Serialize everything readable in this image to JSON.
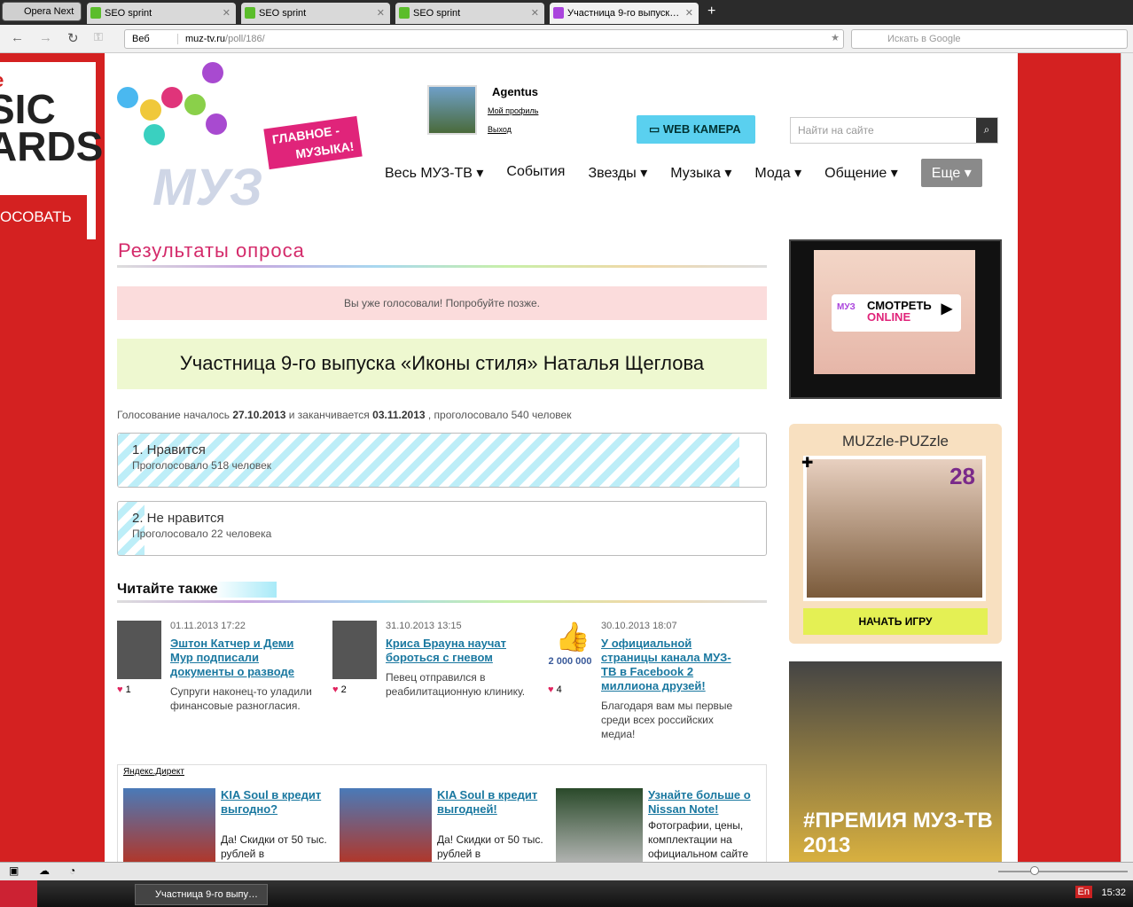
{
  "browser": {
    "opera_label": "Opera Next",
    "tabs": [
      "SEO sprint",
      "SEO sprint",
      "SEO sprint",
      "Участница 9-го выпуск…"
    ],
    "web_label": "Веб",
    "url_host": "muz-tv.ru",
    "url_path": "/poll/186/",
    "search_placeholder": "Искать в Google"
  },
  "leftad": {
    "line1": "ie",
    "line2": "SIC",
    "line3": "ARDS",
    "button": "ОСОВАТЬ"
  },
  "header": {
    "slogan1": "ГЛАВНОЕ -",
    "slogan2": "МУЗЫКА!",
    "logo_text": "МУЗ",
    "username": "Agentus",
    "profile_link": "Мой профиль",
    "logout_link": "Выход",
    "webcam": "WEB КАМЕРА",
    "search_placeholder": "Найти на сайте"
  },
  "nav": [
    "Весь МУЗ-ТВ ▾",
    "События",
    "Звезды ▾",
    "Музыка ▾",
    "Мода ▾",
    "Общение ▾",
    "Еще ▾"
  ],
  "poll": {
    "heading": "Результаты опроса",
    "notice": "Вы уже голосовали! Попробуйте позже.",
    "question": "Участница 9-го выпуска «Иконы стиля» Наталья Щеглова",
    "meta_prefix": "Голосование началось",
    "start": "27.10.2013",
    "meta_mid": "и заканчивается",
    "end": "03.11.2013",
    "meta_suffix": ", проголосовало 540 человек",
    "options": [
      {
        "title": "1.  Нравится",
        "votes_text": "Проголосовало 518 человек",
        "percent": 95.9
      },
      {
        "title": "2.  Не нравится",
        "votes_text": "Проголосовало 22 человека",
        "percent": 4.1
      }
    ]
  },
  "read_also": {
    "heading": "Читайте также",
    "items": [
      {
        "date": "01.11.2013 17:22",
        "title": "Эштон Катчер и Деми Мур подписали документы о разводе",
        "likes": "1",
        "desc": "Супруги наконец-то уладили финансовые разногласия."
      },
      {
        "date": "31.10.2013 13:15",
        "title": "Криса Брауна научат бороться с гневом",
        "likes": "2",
        "desc": "Певец отправился в реабилитационную клинику."
      },
      {
        "date": "30.10.2013 18:07",
        "title": "У официальной страницы канала МУЗ-ТВ в Facebook 2 миллиона друзей!",
        "likes": "4",
        "desc": "Благодаря вам мы первые среди всех российских медиа!",
        "img_text": "2 000 000"
      }
    ]
  },
  "direct": {
    "label": "Яндекс.Директ",
    "ads": [
      {
        "title": "KIA Soul в кредит выгодно?",
        "desc": "Да! Скидки от 50 тыс. рублей в"
      },
      {
        "title": "KIA Soul в кредит выгодней!",
        "desc": "Да! Скидки от 50 тыс. рублей в"
      },
      {
        "title": "Узнайте больше о Nissan Note!",
        "desc": "Фотографии, цены, комплектации на официальном сайте"
      }
    ]
  },
  "sidebar": {
    "watch1": "СМОТРЕТЬ",
    "watch2": "ONLINE",
    "tv_logo": "МУЗ",
    "puzzle_title": "MUZzle-PUZzle",
    "puzzle_num": "28",
    "puzzle_button": "НАЧАТЬ ИГРУ",
    "premia": "#ПРЕМИЯ МУЗ-ТВ 2013"
  },
  "taskbar": {
    "task": "Участница 9-го выпу…",
    "lang": "En",
    "clock": "15:32"
  },
  "colors": {
    "page_bg": "#d42121",
    "accent": "#d42a6a",
    "link": "#1a78a0",
    "webcam": "#5ad0ef"
  }
}
